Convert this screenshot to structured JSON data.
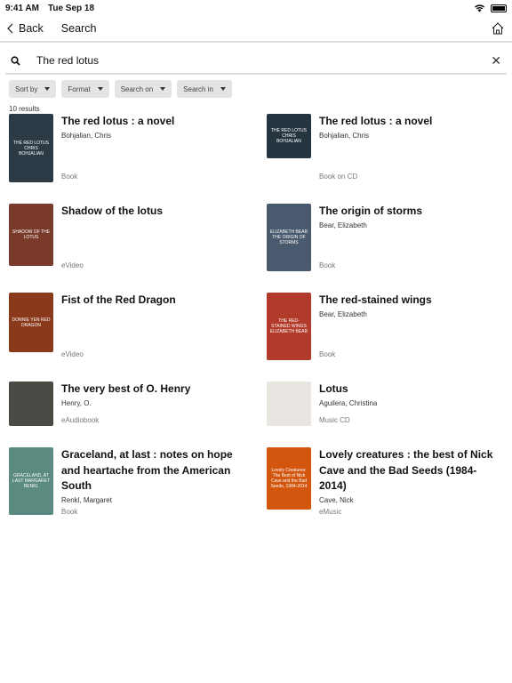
{
  "status": {
    "time": "9:41 AM",
    "date": "Tue Sep 18"
  },
  "nav": {
    "back": "Back",
    "title": "Search"
  },
  "search": {
    "value": "The red lotus",
    "placeholder": ""
  },
  "filters": [
    "Sort by",
    "Format",
    "Search on",
    "Search in"
  ],
  "result_count": "10 results",
  "results": [
    {
      "title": "The red lotus : a novel",
      "author": "Bohjalian, Chris",
      "format": "Book",
      "cover_color": "#2b3a44",
      "cover_text": "THE RED LOTUS CHRIS BOHJALIAN"
    },
    {
      "title": "The red lotus : a novel",
      "author": "Bohjalian, Chris",
      "format": "Book on CD",
      "cover_color": "#253540",
      "cover_text": "THE RED LOTUS CHRIS BOHJALIAN"
    },
    {
      "title": "Shadow of the lotus",
      "author": "",
      "format": "eVideo",
      "cover_color": "#7a3a2a",
      "cover_text": "SHADOW OF THE LOTUS"
    },
    {
      "title": "The origin of storms",
      "author": "Bear, Elizabeth",
      "format": "Book",
      "cover_color": "#4a5a6e",
      "cover_text": "ELIZABETH BEAR THE ORIGIN OF STORMS"
    },
    {
      "title": "Fist of the Red Dragon",
      "author": "",
      "format": "eVideo",
      "cover_color": "#8a3a1a",
      "cover_text": "DONNIE YEN RED DRAGON"
    },
    {
      "title": "The red-stained wings",
      "author": "Bear, Elizabeth",
      "format": "Book",
      "cover_color": "#b23a2a",
      "cover_text": "THE RED-STAINED WINGS ELIZABETH BEAR"
    },
    {
      "title": "The very best of O. Henry",
      "author": "Henry, O.",
      "format": "eAudiobook",
      "cover_color": "#4a4a44",
      "cover_text": ""
    },
    {
      "title": "Lotus",
      "author": "Aguilera, Christina",
      "format": "Music CD",
      "cover_color": "#e8e4e0",
      "cover_text": ""
    },
    {
      "title": "Graceland, at last : notes on hope and heartache from the American South",
      "author": "Renkl, Margaret",
      "format": "Book",
      "cover_color": "#5a8a80",
      "cover_text": "GRACELAND, AT LAST MARGARET RENKL"
    },
    {
      "title": "Lovely creatures : the best of Nick Cave and the Bad Seeds (1984-2014)",
      "author": "Cave, Nick",
      "format": "eMusic",
      "cover_color": "#d2560e",
      "cover_text": "Lovely Creatures: The Best of Nick Cave and the Bad Seeds, 1984-2014"
    }
  ]
}
